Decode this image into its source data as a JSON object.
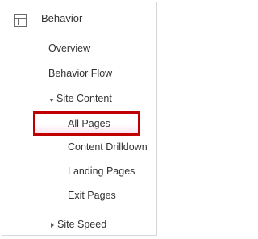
{
  "section": {
    "title": "Behavior",
    "icon": "layout-icon"
  },
  "menu": {
    "overview": "Overview",
    "behavior_flow": "Behavior Flow",
    "site_content": "Site Content",
    "site_content_items": [
      "All Pages",
      "Content Drilldown",
      "Landing Pages",
      "Exit Pages"
    ],
    "site_speed": "Site Speed"
  },
  "colors": {
    "highlight_border": "#c00000",
    "text": "#333333"
  }
}
